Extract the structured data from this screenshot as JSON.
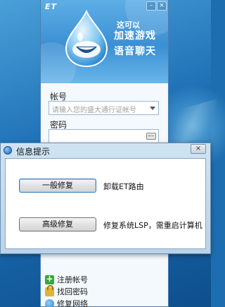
{
  "et_window": {
    "logo": "ET",
    "minimize_glyph": "–",
    "close_glyph": "×",
    "slogan_line1": "这可以",
    "slogan_line2": "加速游戏",
    "slogan_line3": "语音聊天",
    "account_label": "帐号",
    "account_placeholder": "请输入您的盛大通行证帐号",
    "password_label": "密码",
    "links": [
      {
        "label": "注册帐号",
        "icon": "register-icon"
      },
      {
        "label": "找回密码",
        "icon": "lock-icon"
      },
      {
        "label": "修复网络",
        "icon": "globe-icon"
      }
    ]
  },
  "dialog": {
    "title": "信息提示",
    "close_glyph": "×",
    "normal_repair_button": "一般修复",
    "normal_repair_desc": "卸载ET路由",
    "advanced_repair_button": "高级修复",
    "advanced_repair_desc": "修复系统LSP，需重启计算机"
  },
  "colors": {
    "header_blue": "#3b8fd3",
    "desktop_blue": "#1b6db3",
    "dialog_frame": "#b9d3ea"
  }
}
